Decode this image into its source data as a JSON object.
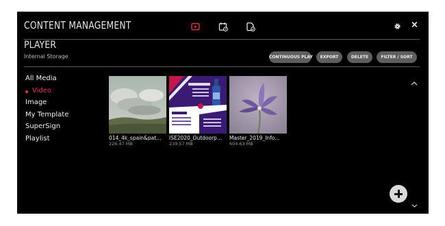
{
  "header": {
    "title": "CONTENT MANAGEMENT",
    "tabs": [
      {
        "icon": "player-icon",
        "active": true,
        "color": "#e0344a"
      },
      {
        "icon": "scheduler-icon",
        "active": false
      },
      {
        "icon": "template-editor-icon",
        "active": false
      }
    ],
    "settings_icon": "gear-icon",
    "close_label": "×"
  },
  "section": {
    "title": "PLAYER",
    "storage": "Internal Storage"
  },
  "toolbar": {
    "continuous_play": "CONTINUOUS PLAY",
    "export": "EXPORT",
    "delete": "DELETE",
    "filter_sort": "FILTER / SORT"
  },
  "nav": {
    "items": [
      {
        "label": "All Media",
        "active": false
      },
      {
        "label": "Video",
        "active": true
      },
      {
        "label": "Image",
        "active": false
      },
      {
        "label": "My Template",
        "active": false
      },
      {
        "label": "SuperSign",
        "active": false
      },
      {
        "label": "Playlist",
        "active": false
      }
    ]
  },
  "media": [
    {
      "name": "014_4k_spain&pat...",
      "size": "226.47 MB"
    },
    {
      "name": "ISE2020_Outdoorp...",
      "size": "239.57 MB"
    },
    {
      "name": "Master_2019_Info...",
      "size": "604.63 MB"
    }
  ],
  "colors": {
    "accent": "#e0344a",
    "background": "#000000",
    "button": "#5e5e5e"
  }
}
